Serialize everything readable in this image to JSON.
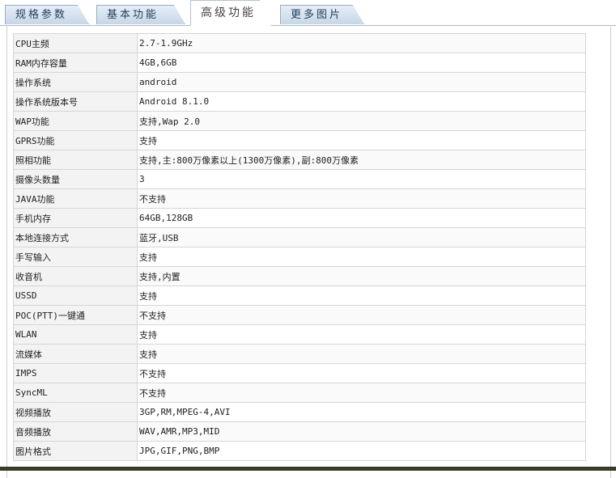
{
  "tabs": [
    {
      "label": "规格参数",
      "active": false
    },
    {
      "label": "基本功能",
      "active": false
    },
    {
      "label": "高级功能",
      "active": true
    },
    {
      "label": "更多图片",
      "active": false
    }
  ],
  "specs": [
    {
      "key": "CPU主频",
      "value": "2.7-1.9GHz"
    },
    {
      "key": "RAM内存容量",
      "value": "4GB,6GB"
    },
    {
      "key": "操作系统",
      "value": "android"
    },
    {
      "key": "操作系统版本号",
      "value": "Android 8.1.0"
    },
    {
      "key": "WAP功能",
      "value": "支持,Wap 2.0"
    },
    {
      "key": "GPRS功能",
      "value": "支持"
    },
    {
      "key": "照相功能",
      "value": "支持,主:800万像素以上(1300万像素),副:800万像素"
    },
    {
      "key": "摄像头数量",
      "value": "3"
    },
    {
      "key": "JAVA功能",
      "value": "不支持"
    },
    {
      "key": "手机内存",
      "value": "64GB,128GB"
    },
    {
      "key": "本地连接方式",
      "value": "蓝牙,USB"
    },
    {
      "key": "手写输入",
      "value": "支持"
    },
    {
      "key": "收音机",
      "value": "支持,内置"
    },
    {
      "key": "USSD",
      "value": "支持"
    },
    {
      "key": "POC(PTT)一键通",
      "value": "不支持"
    },
    {
      "key": "WLAN",
      "value": "支持"
    },
    {
      "key": "流媒体",
      "value": "支持"
    },
    {
      "key": "IMPS",
      "value": "不支持"
    },
    {
      "key": "SyncML",
      "value": "不支持"
    },
    {
      "key": "视频播放",
      "value": "3GP,RM,MPEG-4,AVI"
    },
    {
      "key": "音频播放",
      "value": "WAV,AMR,MP3,MID"
    },
    {
      "key": "图片格式",
      "value": "JPG,GIF,PNG,BMP"
    }
  ]
}
